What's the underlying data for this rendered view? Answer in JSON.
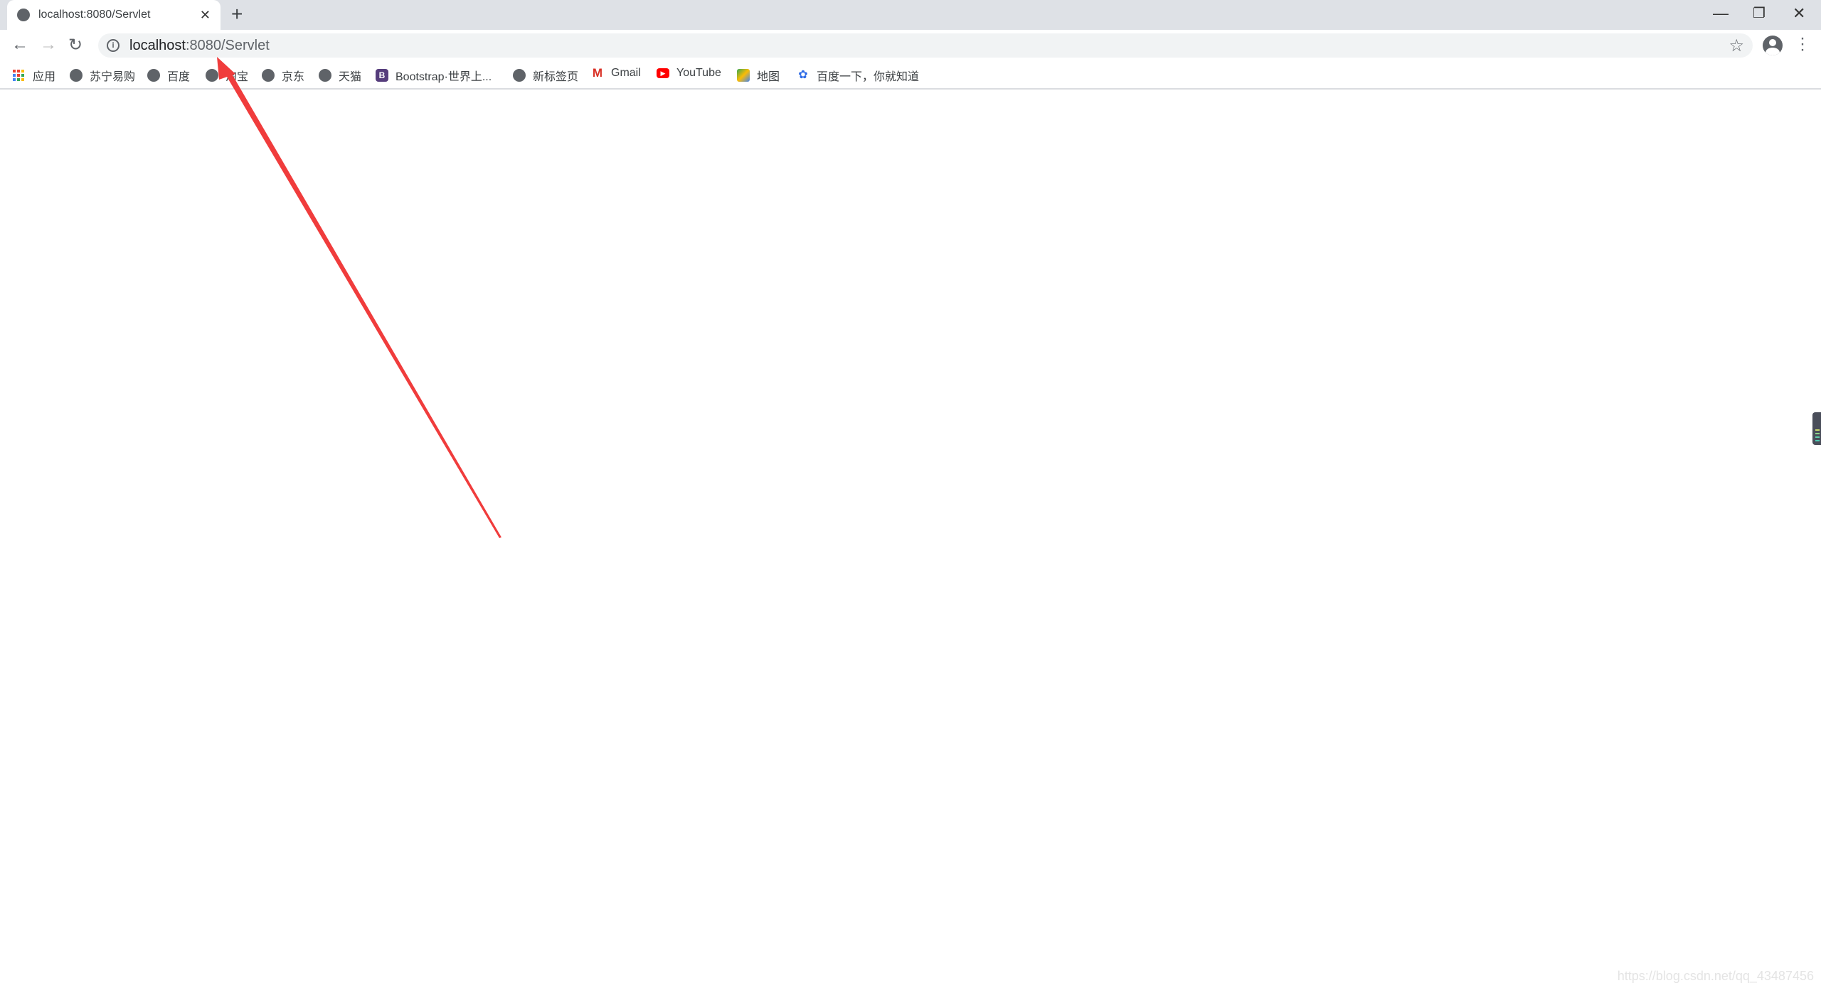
{
  "tab": {
    "title": "localhost:8080/Servlet",
    "icon": "globe-icon"
  },
  "address": {
    "host": "localhost",
    "path": ":8080/Servlet"
  },
  "bookmarks": [
    {
      "label": "应用",
      "icon": "apps-icon"
    },
    {
      "label": "苏宁易购",
      "icon": "globe-icon"
    },
    {
      "label": "百度",
      "icon": "globe-icon"
    },
    {
      "label": "淘宝",
      "icon": "globe-icon"
    },
    {
      "label": "京东",
      "icon": "globe-icon"
    },
    {
      "label": "天猫",
      "icon": "globe-icon"
    },
    {
      "label": "Bootstrap·世界上...",
      "icon": "bootstrap-icon"
    },
    {
      "label": "新标签页",
      "icon": "globe-icon"
    },
    {
      "label": "Gmail",
      "icon": "gmail-icon"
    },
    {
      "label": "YouTube",
      "icon": "youtube-icon"
    },
    {
      "label": "地图",
      "icon": "maps-icon"
    },
    {
      "label": "百度一下，你就知道",
      "icon": "baidu-icon"
    }
  ],
  "annotation": {
    "color": "#f03c3c"
  },
  "watermark": "https://blog.csdn.net/qq_43487456"
}
